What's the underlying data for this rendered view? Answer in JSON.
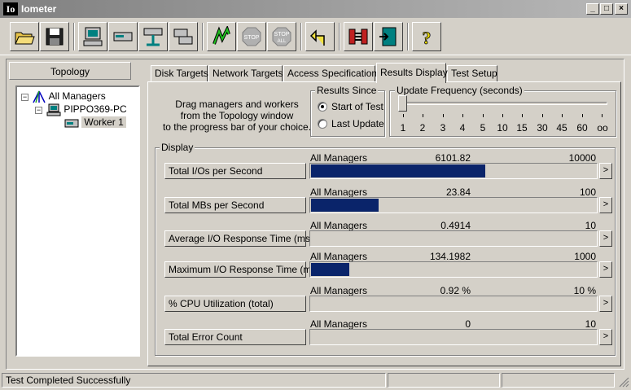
{
  "window": {
    "logo": "Io",
    "title": "Iometer",
    "buttons": {
      "minimize": "_",
      "maximize": "□",
      "close": "×"
    }
  },
  "toolbar": {
    "stop_label": "STOP",
    "stop_all_label": "STOP",
    "stop_all_sub": "ALL",
    "help_label": "?"
  },
  "topology": {
    "header": "Topology",
    "items": [
      {
        "label": "All Managers"
      },
      {
        "label": "PIPPO369-PC"
      },
      {
        "label": "Worker 1"
      }
    ]
  },
  "tabs": [
    {
      "label": "Disk Targets"
    },
    {
      "label": "Network Targets"
    },
    {
      "label": "Access Specifications"
    },
    {
      "label": "Results Display"
    },
    {
      "label": "Test Setup"
    }
  ],
  "instructions": {
    "line1": "Drag managers and workers",
    "line2": "from the Topology window",
    "line3": "to the progress bar of your choice."
  },
  "results_since": {
    "label": "Results Since",
    "options": [
      {
        "label": "Start of Test",
        "selected": true
      },
      {
        "label": "Last Update",
        "selected": false
      }
    ]
  },
  "update_frequency": {
    "label": "Update Frequency (seconds)",
    "ticks": [
      "1",
      "2",
      "3",
      "4",
      "5",
      "10",
      "15",
      "30",
      "45",
      "60",
      "oo"
    ],
    "selected_index": 0
  },
  "display": {
    "label": "Display",
    "rows": [
      {
        "metric": "Total I/Os per Second",
        "source": "All Managers",
        "value": "6101.82",
        "max": "10000",
        "fraction": 0.61,
        "arrow": ">"
      },
      {
        "metric": "Total MBs per Second",
        "source": "All Managers",
        "value": "23.84",
        "max": "100",
        "fraction": 0.2384,
        "arrow": ">"
      },
      {
        "metric": "Average I/O Response Time (ms)",
        "source": "All Managers",
        "value": "0.4914",
        "max": "10",
        "fraction": 0.0,
        "arrow": ">"
      },
      {
        "metric": "Maximum I/O Response Time (ms)",
        "source": "All Managers",
        "value": "134.1982",
        "max": "1000",
        "fraction": 0.134,
        "arrow": ">"
      },
      {
        "metric": "% CPU Utilization (total)",
        "source": "All Managers",
        "value": "0.92 %",
        "max": "10 %",
        "fraction": 0.0,
        "arrow": ">"
      },
      {
        "metric": "Total Error Count",
        "source": "All Managers",
        "value": "0",
        "max": "10",
        "fraction": 0.0,
        "arrow": ">"
      }
    ]
  },
  "status": {
    "message": "Test Completed Successfully"
  },
  "colors": {
    "bar_fill": "#0a246a",
    "window_bg": "#d4d0c8"
  }
}
